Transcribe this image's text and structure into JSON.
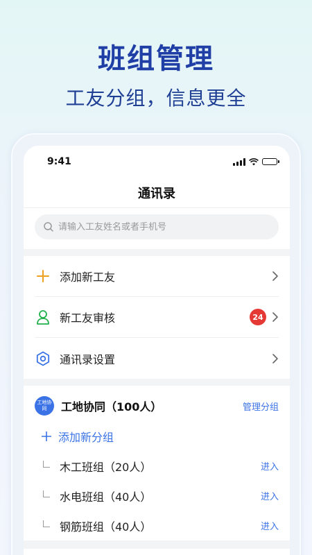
{
  "promo": {
    "title": "班组管理",
    "subtitle": "工友分组，信息更全"
  },
  "status_bar": {
    "time": "9:41"
  },
  "nav": {
    "title": "通讯录"
  },
  "search": {
    "placeholder": "请输入工友姓名或者手机号"
  },
  "menu": [
    {
      "label": "添加新工友",
      "icon": "plus-icon",
      "color": "#f0a020"
    },
    {
      "label": "新工友审核",
      "icon": "person-icon",
      "color": "#22b04b",
      "badge": "24"
    },
    {
      "label": "通讯录设置",
      "icon": "gear-icon",
      "color": "#3b73e6"
    }
  ],
  "group": {
    "logo_text": "工地协同",
    "name": "工地协同（100人）",
    "manage_label": "管理分组",
    "add_label": "添加新分组",
    "teams": [
      {
        "name": "木工班组（20人）",
        "action": "进入"
      },
      {
        "name": "水电班组（40人）",
        "action": "进入"
      },
      {
        "name": "钢筋班组（40人）",
        "action": "进入"
      }
    ]
  },
  "colors": {
    "accent": "#3b73e6",
    "title": "#1f3fa6",
    "badge": "#e53935"
  }
}
